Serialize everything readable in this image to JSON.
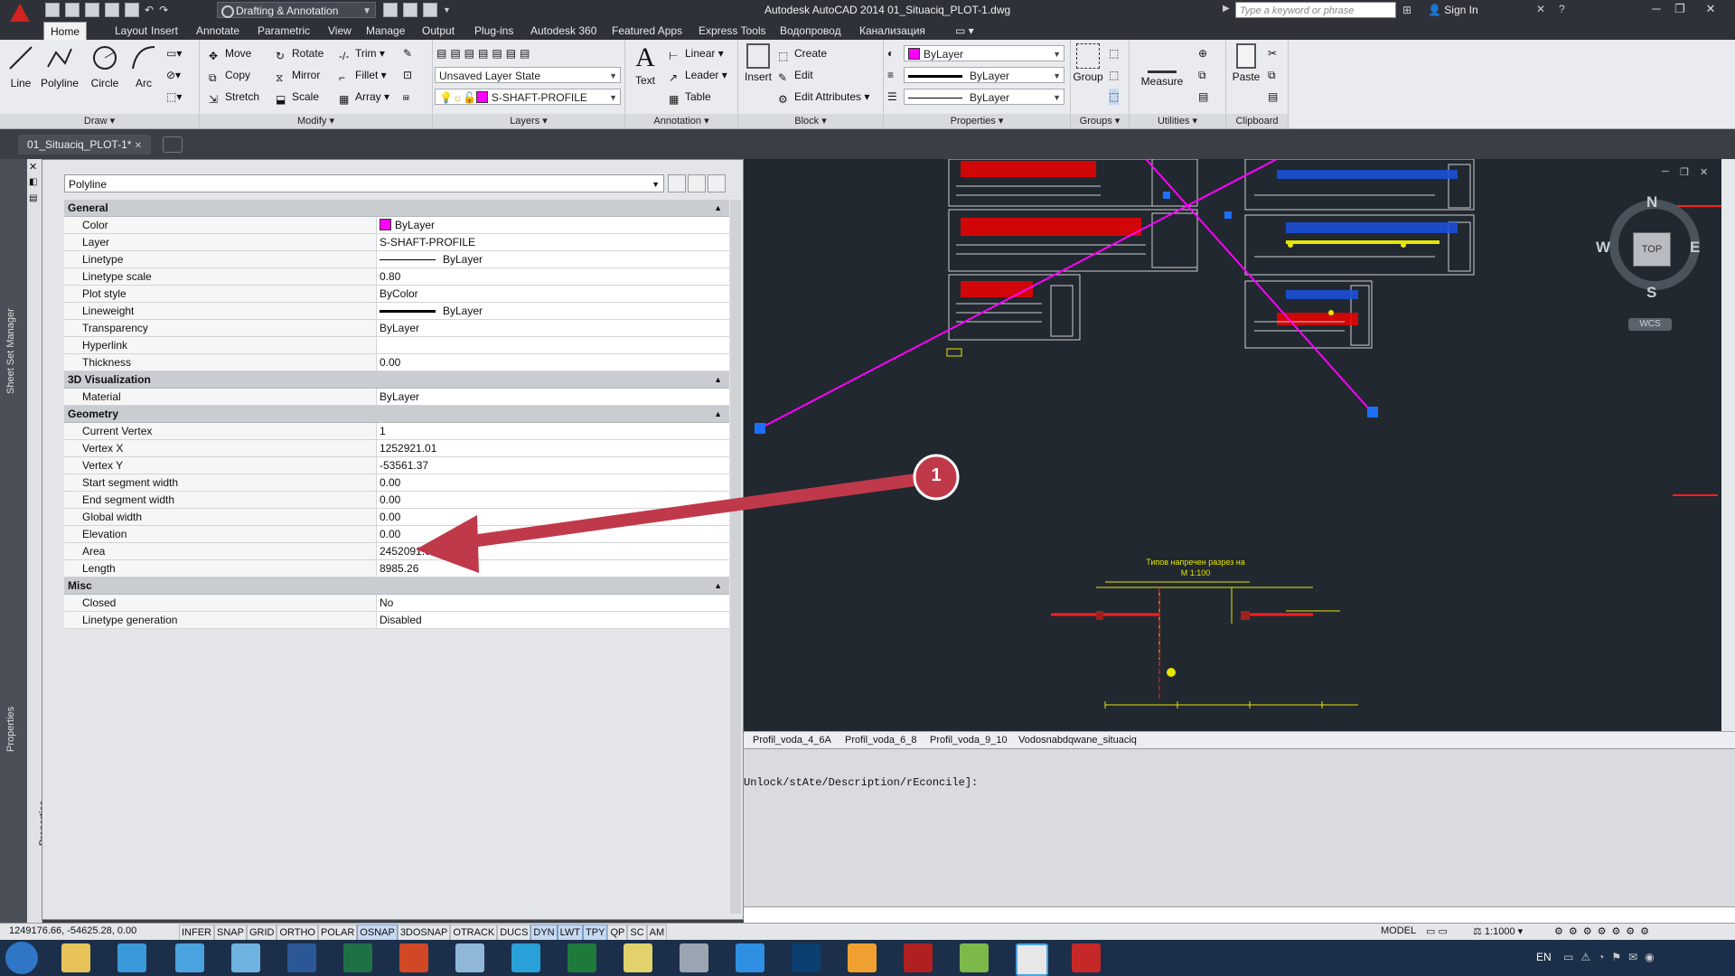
{
  "window": {
    "title": "Autodesk AutoCAD 2014    01_Situaciq_PLOT-1.dwg",
    "workspace": "Drafting & Annotation",
    "search_placeholder": "Type a keyword or phrase",
    "sign_in": "Sign In"
  },
  "ribbon_tabs": [
    "Home",
    "Layout",
    "Insert",
    "Annotate",
    "Parametric",
    "View",
    "Manage",
    "Output",
    "Plug-ins",
    "Autodesk 360",
    "Featured Apps",
    "Express Tools",
    "Водопровод",
    "Канализация"
  ],
  "ribbon": {
    "draw": {
      "title": "Draw",
      "line": "Line",
      "polyline": "Polyline",
      "circle": "Circle",
      "arc": "Arc"
    },
    "modify": {
      "title": "Modify",
      "move": "Move",
      "rotate": "Rotate",
      "trim": "Trim",
      "copy": "Copy",
      "mirror": "Mirror",
      "fillet": "Fillet",
      "stretch": "Stretch",
      "scale": "Scale",
      "array": "Array"
    },
    "layers": {
      "title": "Layers",
      "layer_state": "Unsaved Layer State",
      "current_layer": "S-SHAFT-PROFILE"
    },
    "annotation": {
      "title": "Annotation",
      "text": "Text",
      "linear": "Linear",
      "leader": "Leader",
      "table": "Table"
    },
    "block": {
      "title": "Block",
      "insert": "Insert",
      "create": "Create",
      "edit": "Edit",
      "edit_attributes": "Edit Attributes"
    },
    "properties": {
      "title": "Properties",
      "color": "ByLayer",
      "linetype": "ByLayer",
      "lineweight": "ByLayer"
    },
    "groups": {
      "title": "Groups",
      "group": "Group"
    },
    "utilities": {
      "title": "Utilities",
      "measure": "Measure"
    },
    "clipboard": {
      "title": "Clipboard",
      "paste": "Paste"
    }
  },
  "document_tab": "01_Situaciq_PLOT-1*",
  "properties_palette": {
    "object_type": "Polyline",
    "side_labels": {
      "sheet_set": "Sheet Set Manager",
      "properties": "Properties"
    },
    "categories": [
      {
        "name": "General",
        "rows": [
          {
            "k": "Color",
            "v": "ByLayer",
            "kind": "color"
          },
          {
            "k": "Layer",
            "v": "S-SHAFT-PROFILE"
          },
          {
            "k": "Linetype",
            "v": "ByLayer",
            "kind": "linetype"
          },
          {
            "k": "Linetype scale",
            "v": "0.80"
          },
          {
            "k": "Plot style",
            "v": "ByColor"
          },
          {
            "k": "Lineweight",
            "v": "ByLayer",
            "kind": "lineweight"
          },
          {
            "k": "Transparency",
            "v": "ByLayer"
          },
          {
            "k": "Hyperlink",
            "v": ""
          },
          {
            "k": "Thickness",
            "v": "0.00"
          }
        ]
      },
      {
        "name": "3D Visualization",
        "rows": [
          {
            "k": "Material",
            "v": "ByLayer"
          }
        ]
      },
      {
        "name": "Geometry",
        "rows": [
          {
            "k": "Current Vertex",
            "v": "1"
          },
          {
            "k": "Vertex X",
            "v": "1252921.01"
          },
          {
            "k": "Vertex Y",
            "v": "-53561.37"
          },
          {
            "k": "Start segment width",
            "v": "0.00"
          },
          {
            "k": "End segment width",
            "v": "0.00"
          },
          {
            "k": "Global width",
            "v": "0.00"
          },
          {
            "k": "Elevation",
            "v": "0.00"
          },
          {
            "k": "Area",
            "v": "2452091.06"
          },
          {
            "k": "Length",
            "v": "8985.26"
          }
        ]
      },
      {
        "name": "Misc",
        "rows": [
          {
            "k": "Closed",
            "v": "No"
          },
          {
            "k": "Linetype generation",
            "v": "Disabled"
          }
        ]
      }
    ]
  },
  "callout_number": "1",
  "viewcube": {
    "n": "N",
    "s": "S",
    "e": "E",
    "w": "W",
    "top": "TOP",
    "wcs": "WCS"
  },
  "drawing_text": {
    "section_title": "Типов напречен разрез на",
    "section_scale": "М 1:100"
  },
  "layout_tabs": [
    "Profil_voda_4_6A",
    "Profil_voda_6_8",
    "Profil_voda_9_10",
    "Vodosnabdqwane_situaciq"
  ],
  "command_history": "Unlock/stAte/Description/rEconcile]:",
  "status": {
    "coords": "1249176.66, -54625.28, 0.00",
    "toggles": [
      {
        "label": "INFER",
        "on": false
      },
      {
        "label": "SNAP",
        "on": false
      },
      {
        "label": "GRID",
        "on": false
      },
      {
        "label": "ORTHO",
        "on": false
      },
      {
        "label": "POLAR",
        "on": false
      },
      {
        "label": "OSNAP",
        "on": true
      },
      {
        "label": "3DOSNAP",
        "on": false
      },
      {
        "label": "OTRACK",
        "on": false
      },
      {
        "label": "DUCS",
        "on": false
      },
      {
        "label": "DYN",
        "on": true
      },
      {
        "label": "LWT",
        "on": true
      },
      {
        "label": "TPY",
        "on": true
      },
      {
        "label": "QP",
        "on": false
      },
      {
        "label": "SC",
        "on": false
      },
      {
        "label": "AM",
        "on": false
      }
    ],
    "model": "MODEL",
    "scale": "1:1000"
  },
  "taskbar": {
    "lang": "EN"
  },
  "colors": {
    "accent": "#d32222",
    "polyline": "#ff00ff",
    "callout": "#c0394b",
    "model_bg": "#212830"
  }
}
